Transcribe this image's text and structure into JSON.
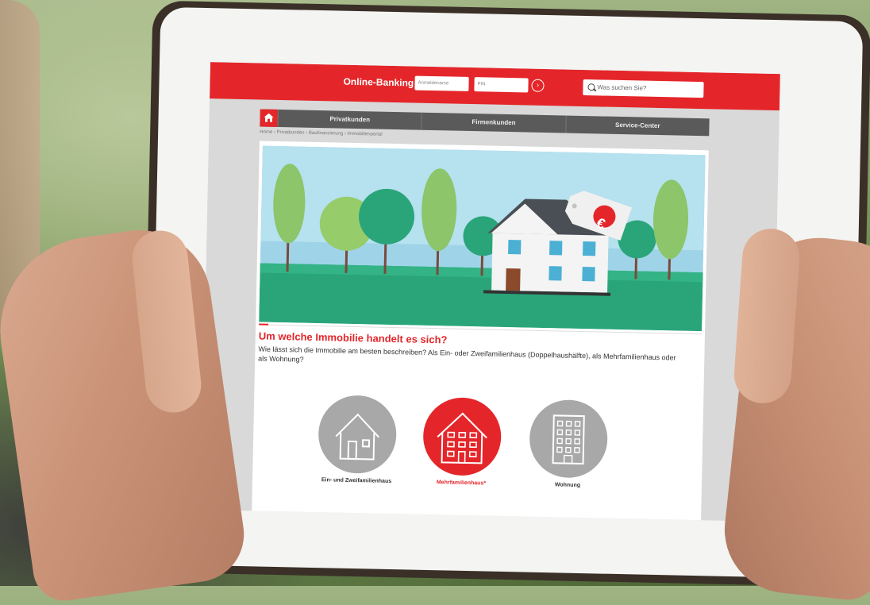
{
  "header": {
    "online_banking_label": "Online-Banking",
    "login_field_placeholder": "Anmeldename",
    "pin_field_placeholder": "PIN",
    "go_symbol": "›",
    "search_placeholder": "Was suchen Sie?"
  },
  "nav": {
    "items": [
      "Privatkunden",
      "Firmenkunden",
      "Service-Center"
    ]
  },
  "breadcrumb": "Home › Privatkunden › Baufinanzierung › Immobilienportal",
  "hero": {
    "price_tag_symbol": "€"
  },
  "question": {
    "title": "Um welche Immobilie handelt es sich?",
    "description": "Wie lässt sich die Immobilie am besten beschreiben? Als Ein- oder Zweifamilienhaus (Doppelhaushälfte), als Mehrfamilienhaus oder als Wohnung?"
  },
  "choices": [
    {
      "label": "Ein- und Zweifamilienhaus",
      "selected": false
    },
    {
      "label": "Mehrfamilienhaus*",
      "selected": true
    },
    {
      "label": "Wohnung",
      "selected": false
    }
  ],
  "colors": {
    "brand_red": "#e4262a",
    "nav_gray": "#5a5a5a",
    "choice_gray": "#a8a8a8"
  }
}
